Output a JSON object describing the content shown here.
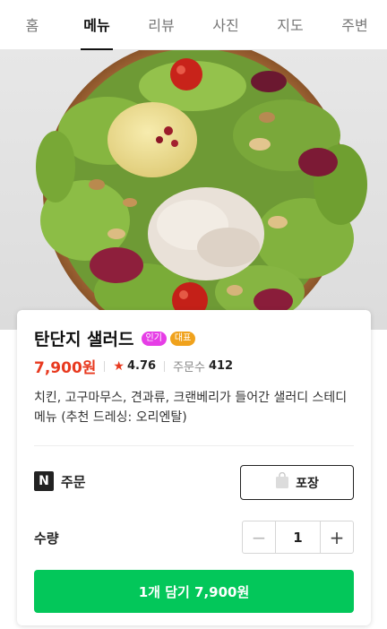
{
  "tabs": [
    {
      "label": "홈",
      "active": false
    },
    {
      "label": "메뉴",
      "active": true
    },
    {
      "label": "리뷰",
      "active": false
    },
    {
      "label": "사진",
      "active": false
    },
    {
      "label": "지도",
      "active": false
    },
    {
      "label": "주변",
      "active": false
    }
  ],
  "menu_item": {
    "name": "탄단지 샐러드",
    "badges": {
      "popular": "인기",
      "representative": "대표"
    },
    "price": "7,900원",
    "rating_icon": "star-icon",
    "rating": "4.76",
    "order_count_label": "주문수",
    "order_count": "412",
    "description": "치킨, 고구마무스, 견과류, 크랜베리가 들어간 샐러디 스테디 메뉴 (추천 드레싱: 오리엔탈)"
  },
  "order": {
    "logo_letter": "N",
    "label": "주문",
    "pack_icon": "shopping-bag-icon",
    "pack_label": "포장"
  },
  "quantity": {
    "label": "수량",
    "minus": "−",
    "value": "1",
    "plus": "+"
  },
  "cart_button": "1개 담기 7,900원",
  "colors": {
    "accent_green": "#03c75a",
    "price_red": "#e8391f",
    "badge_popular": "#e63ee6",
    "badge_representative": "#f0a21c"
  }
}
